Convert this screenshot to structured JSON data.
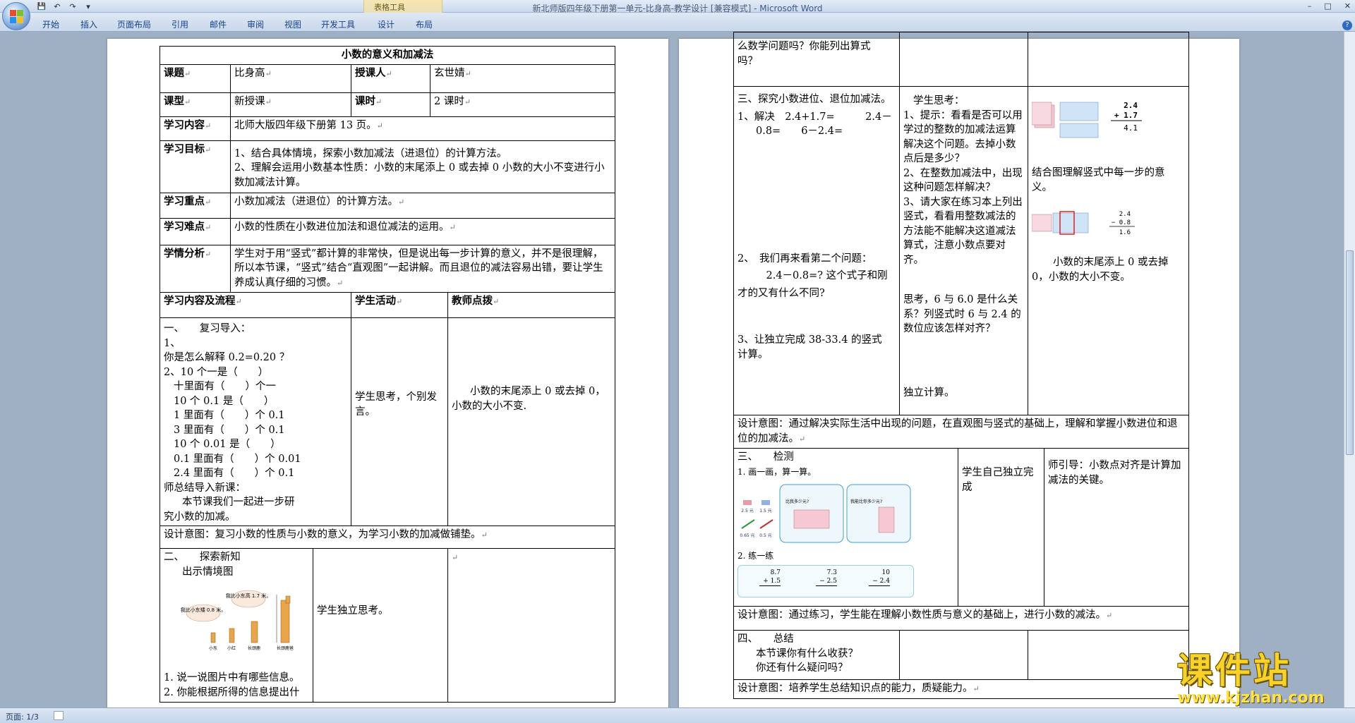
{
  "window": {
    "title": "新北师版四年级下册第一单元-比身高-教学设计 [兼容模式] - ",
    "app": "Microsoft Word",
    "context_tab": "表格工具",
    "buttons": [
      "–",
      "□",
      "✕"
    ]
  },
  "qat": {
    "save": "💾",
    "undo": "↶",
    "redo": "↷",
    "more": "▾"
  },
  "ribbon": {
    "tabs": [
      "开始",
      "插入",
      "页面布局",
      "引用",
      "邮件",
      "审阅",
      "视图",
      "开发工具",
      "设计",
      "布局"
    ]
  },
  "status": {
    "page": "页面: 1/3"
  },
  "help": "?",
  "watermark": {
    "text": "课件站",
    "url": "www.kjzhan.com"
  },
  "page1": {
    "title": "小数的意义和加减法",
    "r1": {
      "a": "课题",
      "b": "比身高",
      "c": "授课人",
      "d": "玄世婧"
    },
    "r2": {
      "a": "课型",
      "b": "新授课",
      "c": "课时",
      "d": "2 课时"
    },
    "r3": {
      "a": "学习内容",
      "b": "北师大版四年级下册第 13 页。"
    },
    "r4": {
      "a": "学习目标",
      "b1": "1、结合具体情境，探索小数加减法（进退位）的计算方法。",
      "b2": "2、理解会运用小数基本性质：小数的末尾添上 0 或去掉 0 小数的大小不变进行小数加减法计算。"
    },
    "r5": {
      "a": "学习重点",
      "b": "小数加减法（进退位）的计算方法。"
    },
    "r6": {
      "a": "学习难点",
      "b": "小数的性质在小数进位加法和退位减法的运用。"
    },
    "r7": {
      "a": "学情分析",
      "b": "学生对于用“竖式”都计算的非常快，但是说出每一步计算的意义，并不是很理解，所以本节课，“竖式”结合“直观图”一起讲解。而且退位的减法容易出错，要让学生养成认真仔细的习惯。"
    },
    "head": {
      "a": "学习内容及流程",
      "b": "学生活动",
      "c": "教师点拨"
    },
    "s1": {
      "lines": [
        "一、　　复习导入：",
        "1、",
        "你是怎么解释 0.2=0.20 ？",
        "2、10 个一是（　　）",
        "十里面有（　　）个一",
        "10 个 0.1 是（　　）",
        "1 里面有（　　）个 0.1",
        "3 里面有（　　）个 0.1",
        "10 个 0.01 是（　　）",
        "0.1 里面有（　　）个 0.01",
        "2.4 里面有（　　）个 0.1",
        "师总结导入新课：",
        "本节课我们一起进一步研",
        "究小数的加减。"
      ],
      "student": "学生思考，个别发言。",
      "teacher": "小数的末尾添上 0 或去掉 0，小数的大小不变."
    },
    "design1": "设计意图：复习小数的性质与小数的意义，为学习小数的加减做铺垫。",
    "s2": {
      "title": "二、　　探索新知",
      "sub": "出示情境图",
      "bubble1": "我比小东矮 0.8 米。",
      "bubble2": "我比小东高 1.7 米。",
      "names": [
        "小东",
        "小红",
        "长颈鹿",
        "长颈鹿爸"
      ],
      "q1": "1. 说一说图片中有哪些信息。",
      "q2": "2. 你能根据所得的信息提出什",
      "student": "学生独立思考。"
    }
  },
  "page2": {
    "top": {
      "l1": "么数学问题吗？你能列出算式",
      "l2": "吗？"
    },
    "s3": {
      "title": "三、探究小数进位、退位加减法。",
      "l1": "1、解决　2.4+1.7=　　　2.4－",
      "l2": "0.8=　　6－2.4=",
      "l3": "2、　我们再来看第二个问题：",
      "l4": "　2.4－0.8=? 这个式子和刚",
      "l5": "才的又有什么不同?",
      "l6": "3、让独立完成 38-33.4 的竖式",
      "l7": "计算。",
      "st": [
        "学生思考：",
        "1、提示：看看是否可以用学过的整数的加减法运算解决这个问题。去掉小数点后是多少？",
        "2、在整数加减法中，出现这种问题怎样解决？",
        "3、请大家在练习本上列出竖式，看看用整数减法的方法能不能解决这道减法算式，注意小数点要对齐。",
        "思考，6 与 6.0 是什么关系？列竖式时 6 与 2.4 的数位应该怎样对齐？",
        "独立计算。"
      ],
      "tc1": "结合图理解竖式中每一步的意义。",
      "tc2": "小数的末尾添上 0 或去掉 0，小数的大小不变。",
      "v1": [
        "2.4",
        "+ 1.7",
        "4.1"
      ],
      "v2": [
        "2.4",
        "− 0.8",
        "1.6"
      ]
    },
    "design2": "设计意图：通过解决实际生活中出现的问题，在直观图与竖式的基础上，理解和掌握小数进位和退位的加减法。",
    "s4": {
      "title": "三、　　检测",
      "p1": "1. 画一画，算一算。",
      "p2": "2. 练一练",
      "st": "学生自己独立完成",
      "tc": "师引导：小数点对齐是计算加减法的关键。",
      "tags": [
        "2.5 元",
        "1.5 元",
        "0.65 元",
        "0.5 元"
      ],
      "q1": "比我多少元?",
      "q2": "我能比你多少元?",
      "ex": [
        [
          "8.7",
          "+ 1.5"
        ],
        [
          "7.3",
          "− 2.5"
        ],
        [
          "10",
          "− 2.4"
        ]
      ]
    },
    "design3": "设计意图：通过练习，学生能在理解小数性质与意义的基础上，进行小数的减法。",
    "s5": {
      "title": "四、　　总结",
      "l1": "本节课你有什么收获？",
      "l2": "你还有什么疑问吗？"
    },
    "design4": "设计意图：培养学生总结知识点的能力，质疑能力。"
  }
}
